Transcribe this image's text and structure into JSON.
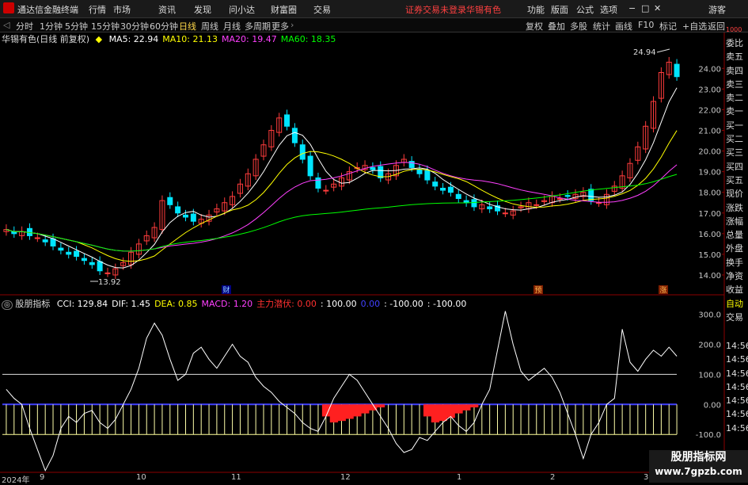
{
  "menubar": {
    "app_name": "通达信金融终端",
    "items": [
      "行情",
      "市场",
      "资讯",
      "发现",
      "问小达",
      "财富圈",
      "交易"
    ],
    "warning": "证券交易未登录",
    "stock": "华锡有色",
    "right_items": [
      "功能",
      "版面",
      "公式",
      "选项"
    ],
    "guest": "游客",
    "window_controls": [
      "−",
      "□",
      "✕"
    ]
  },
  "periodbar": {
    "periods": [
      "分时",
      "1分钟",
      "5分钟",
      "15分钟",
      "30分钟",
      "60分钟",
      "日线",
      "周线",
      "月线",
      "多周期",
      "更多"
    ],
    "active": "日线",
    "tools": [
      "复权",
      "叠加",
      "多股",
      "统计",
      "画线",
      "F10",
      "标记",
      "+自选",
      "返回"
    ]
  },
  "main_indicator": {
    "title": "华锡有色(日线 前复权)",
    "ma": [
      {
        "label": "MA5: 22.94",
        "color": "#ffffff"
      },
      {
        "label": "MA10: 21.13",
        "color": "#ffff00"
      },
      {
        "label": "MA20: 19.47",
        "color": "#ff40ff"
      },
      {
        "label": "MA60: 18.35",
        "color": "#00ff00"
      }
    ],
    "high_label": "24.94",
    "low_label": "13.92",
    "markers": [
      "财",
      "预",
      "涨"
    ],
    "y_ticks": [
      "24.00",
      "23.00",
      "22.00",
      "21.00",
      "20.00",
      "19.00",
      "18.00",
      "17.00",
      "16.00",
      "15.00",
      "14.00"
    ]
  },
  "sub_indicator": {
    "title": "股朋指标",
    "items": [
      {
        "label": "CCI: 129.84",
        "color": "#ffffff"
      },
      {
        "label": "DIF: 1.45",
        "color": "#ffffff"
      },
      {
        "label": "DEA: 0.85",
        "color": "#ffff00"
      },
      {
        "label": "MACD: 1.20",
        "color": "#ff40ff"
      },
      {
        "label": "主力潜伏: 0.00",
        "color": "#ff3030"
      },
      {
        "label": ": 100.00",
        "color": "#ffffff"
      },
      {
        "label": "0.00",
        "color": "#4040ff"
      },
      {
        "label": ": -100.00",
        "color": "#ffffff"
      },
      {
        "label": ": -100.00",
        "color": "#ffffff"
      }
    ],
    "y_ticks": [
      "300.0",
      "200.0",
      "100.0",
      "0.00",
      "-100.0"
    ]
  },
  "right_panel": {
    "top_label": "1000",
    "items": [
      "委比",
      "卖五",
      "卖四",
      "卖三",
      "卖二",
      "卖一",
      "买一",
      "买二",
      "买三",
      "买四",
      "买五",
      "现价",
      "涨跌",
      "涨幅",
      "总量",
      "外盘",
      "换手",
      "净资",
      "收益",
      "自动",
      "交易"
    ],
    "times": [
      "14:56",
      "14:56",
      "14:56",
      "14:56",
      "14:56",
      "14:56",
      "14:56"
    ]
  },
  "time_axis": {
    "labels": [
      "2024年",
      "9",
      "10",
      "11",
      "12",
      "1",
      "2",
      "3"
    ]
  },
  "watermark": {
    "line1": "股朋指标网",
    "line2": "www.7gpzb.com"
  },
  "colors": {
    "up": "#ff3c3c",
    "down": "#00e5ff",
    "ma5": "#ffffff",
    "ma10": "#ffff00",
    "ma20": "#ff40ff",
    "ma60": "#00ff00"
  },
  "chart_data": {
    "type": "candlestick",
    "price_range": [
      13.5,
      25.2
    ],
    "close_series": [
      16.2,
      16.0,
      16.1,
      15.9,
      15.8,
      15.6,
      15.4,
      15.2,
      15.0,
      14.9,
      14.7,
      14.5,
      14.2,
      14.1,
      14.3,
      14.6,
      15.1,
      15.5,
      15.9,
      16.3,
      17.6,
      17.4,
      17.0,
      16.8,
      16.6,
      16.7,
      16.9,
      17.2,
      17.5,
      17.8,
      18.4,
      18.9,
      19.6,
      20.3,
      21.0,
      21.6,
      21.2,
      20.4,
      19.6,
      18.8,
      18.2,
      18.1,
      18.4,
      18.7,
      19.0,
      19.2,
      19.3,
      19.1,
      18.7,
      18.9,
      19.3,
      19.6,
      19.2,
      18.9,
      18.6,
      18.3,
      18.1,
      18.0,
      17.7,
      17.5,
      17.3,
      17.4,
      17.2,
      17.1,
      17.0,
      17.1,
      17.3,
      17.5,
      17.4,
      17.6,
      17.8,
      17.7,
      17.8,
      17.9,
      18.0,
      17.6,
      17.5,
      17.9,
      18.3,
      18.8,
      19.4,
      20.2,
      21.2,
      22.4,
      23.8,
      24.3,
      23.6
    ],
    "cci_series": [
      50,
      20,
      0,
      -80,
      -150,
      -220,
      -170,
      -80,
      -40,
      -60,
      -30,
      -20,
      -60,
      -80,
      -50,
      0,
      50,
      120,
      220,
      270,
      230,
      150,
      80,
      100,
      170,
      190,
      150,
      120,
      160,
      200,
      160,
      140,
      90,
      60,
      40,
      10,
      -10,
      -30,
      -60,
      -80,
      -90,
      -40,
      20,
      60,
      100,
      80,
      40,
      0,
      -40,
      -80,
      -130,
      -160,
      -150,
      -110,
      -120,
      -90,
      -60,
      -40,
      -70,
      -90,
      -60,
      0,
      50,
      180,
      310,
      200,
      110,
      80,
      100,
      120,
      90,
      40,
      -30,
      -100,
      -180,
      -100,
      -60,
      0,
      20,
      250,
      140,
      110,
      150,
      180,
      160,
      190,
      160
    ],
    "macd_hist_series": [
      0,
      0,
      0,
      0,
      0,
      0,
      0,
      0,
      0,
      0,
      0,
      0,
      0,
      0,
      0,
      0,
      0,
      0,
      0,
      0,
      0,
      0,
      0,
      0,
      0,
      0,
      0,
      0,
      0,
      0,
      0,
      0,
      0,
      0,
      0,
      0,
      0,
      0,
      0,
      0,
      0,
      -40,
      -60,
      -55,
      -48,
      -40,
      -30,
      -20,
      -10,
      0,
      0,
      0,
      0,
      0,
      -40,
      -60,
      -55,
      -45,
      -30,
      -20,
      -10,
      0,
      0,
      0,
      0,
      0,
      0,
      0,
      0,
      0,
      0,
      0,
      0,
      0,
      0,
      0,
      0,
      0,
      0,
      0,
      0,
      0,
      0,
      0,
      0,
      0,
      0
    ]
  }
}
